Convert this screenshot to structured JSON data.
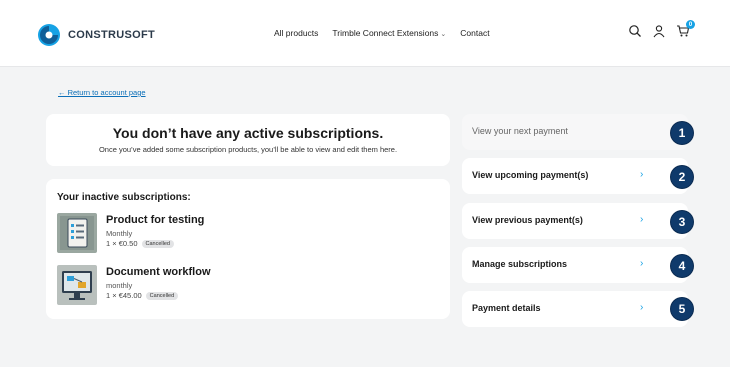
{
  "brand": {
    "name": "CONSTRUSOFT",
    "accent": "#16a2e5",
    "dark": "#0f3a6b"
  },
  "nav": {
    "items": [
      "All products",
      "Trimble Connect Extensions",
      "Contact"
    ],
    "dropdown_icon": "chevron-down-icon"
  },
  "header_icons": {
    "search": "search-icon",
    "account": "user-icon",
    "cart": "cart-icon",
    "cart_count": "0"
  },
  "return_link": "← Return to account page",
  "empty_state": {
    "title": "You don’t have any active subscriptions.",
    "text": "Once you’ve added some subscription products, you’ll be able to view and edit them here."
  },
  "inactive": {
    "title": "Your inactive subscriptions:",
    "items": [
      {
        "name": "Product for testing",
        "period": "Monthly",
        "price": "1 × €0.50",
        "status": "Cancelled"
      },
      {
        "name": "Document workflow",
        "period": "monthly",
        "price": "1 × €45.00",
        "status": "Cancelled"
      }
    ]
  },
  "actions": [
    {
      "label": "View your next payment",
      "number": "1",
      "enabled": false
    },
    {
      "label": "View upcoming payment(s)",
      "number": "2",
      "enabled": true
    },
    {
      "label": "View previous payment(s)",
      "number": "3",
      "enabled": true
    },
    {
      "label": "Manage subscriptions",
      "number": "4",
      "enabled": true
    },
    {
      "label": "Payment details",
      "number": "5",
      "enabled": true
    }
  ],
  "chevron": "›"
}
